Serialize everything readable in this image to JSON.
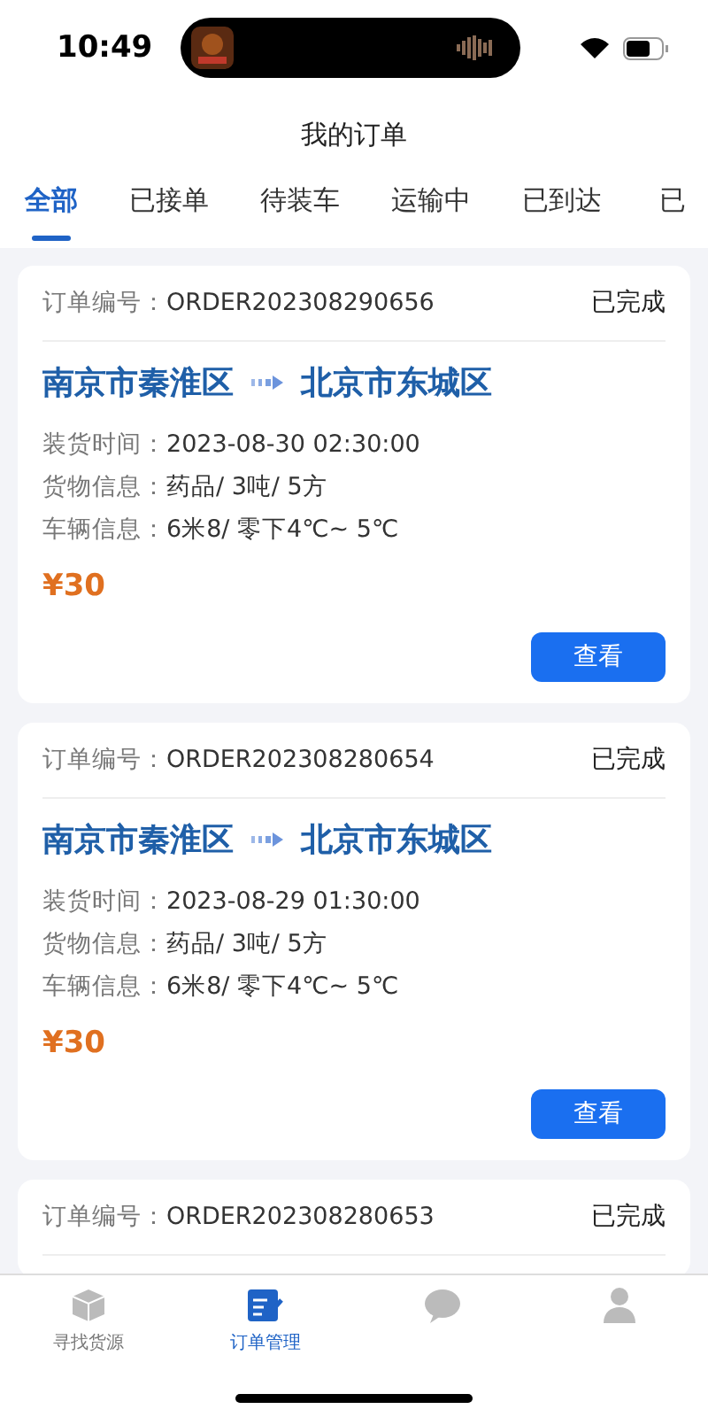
{
  "status_bar": {
    "time": "10:49"
  },
  "header": {
    "title": "我的订单"
  },
  "tabs": [
    {
      "label": "全部",
      "selected": true
    },
    {
      "label": "已接单",
      "selected": false
    },
    {
      "label": "待装车",
      "selected": false
    },
    {
      "label": "运输中",
      "selected": false
    },
    {
      "label": "已到达",
      "selected": false
    },
    {
      "label": "已",
      "selected": false
    }
  ],
  "orders": [
    {
      "order_label": "订单编号：",
      "order_no": "ORDER202308290656",
      "status": "已完成",
      "from": "南京市秦淮区",
      "to": "北京市东城区",
      "details": [
        {
          "label": "装货时间：",
          "value": "2023-08-30 02:30:00"
        },
        {
          "label": "货物信息：",
          "value": "药品/ 3吨/ 5方"
        },
        {
          "label": "车辆信息：",
          "value": "6米8/ 零下4℃~ 5℃"
        }
      ],
      "price": "¥30",
      "button": "查看"
    },
    {
      "order_label": "订单编号：",
      "order_no": "ORDER202308280654",
      "status": "已完成",
      "from": "南京市秦淮区",
      "to": "北京市东城区",
      "details": [
        {
          "label": "装货时间：",
          "value": "2023-08-29 01:30:00"
        },
        {
          "label": "货物信息：",
          "value": "药品/ 3吨/ 5方"
        },
        {
          "label": "车辆信息：",
          "value": "6米8/ 零下4℃~ 5℃"
        }
      ],
      "price": "¥30",
      "button": "查看"
    },
    {
      "order_label": "订单编号：",
      "order_no": "ORDER202308280653",
      "status": "已完成"
    }
  ],
  "nav": [
    {
      "kind": "box",
      "label": "寻找货源",
      "selected": false
    },
    {
      "kind": "edit",
      "label": "订单管理",
      "selected": true
    },
    {
      "kind": "chat",
      "selected": false
    },
    {
      "kind": "person",
      "selected": false
    }
  ]
}
